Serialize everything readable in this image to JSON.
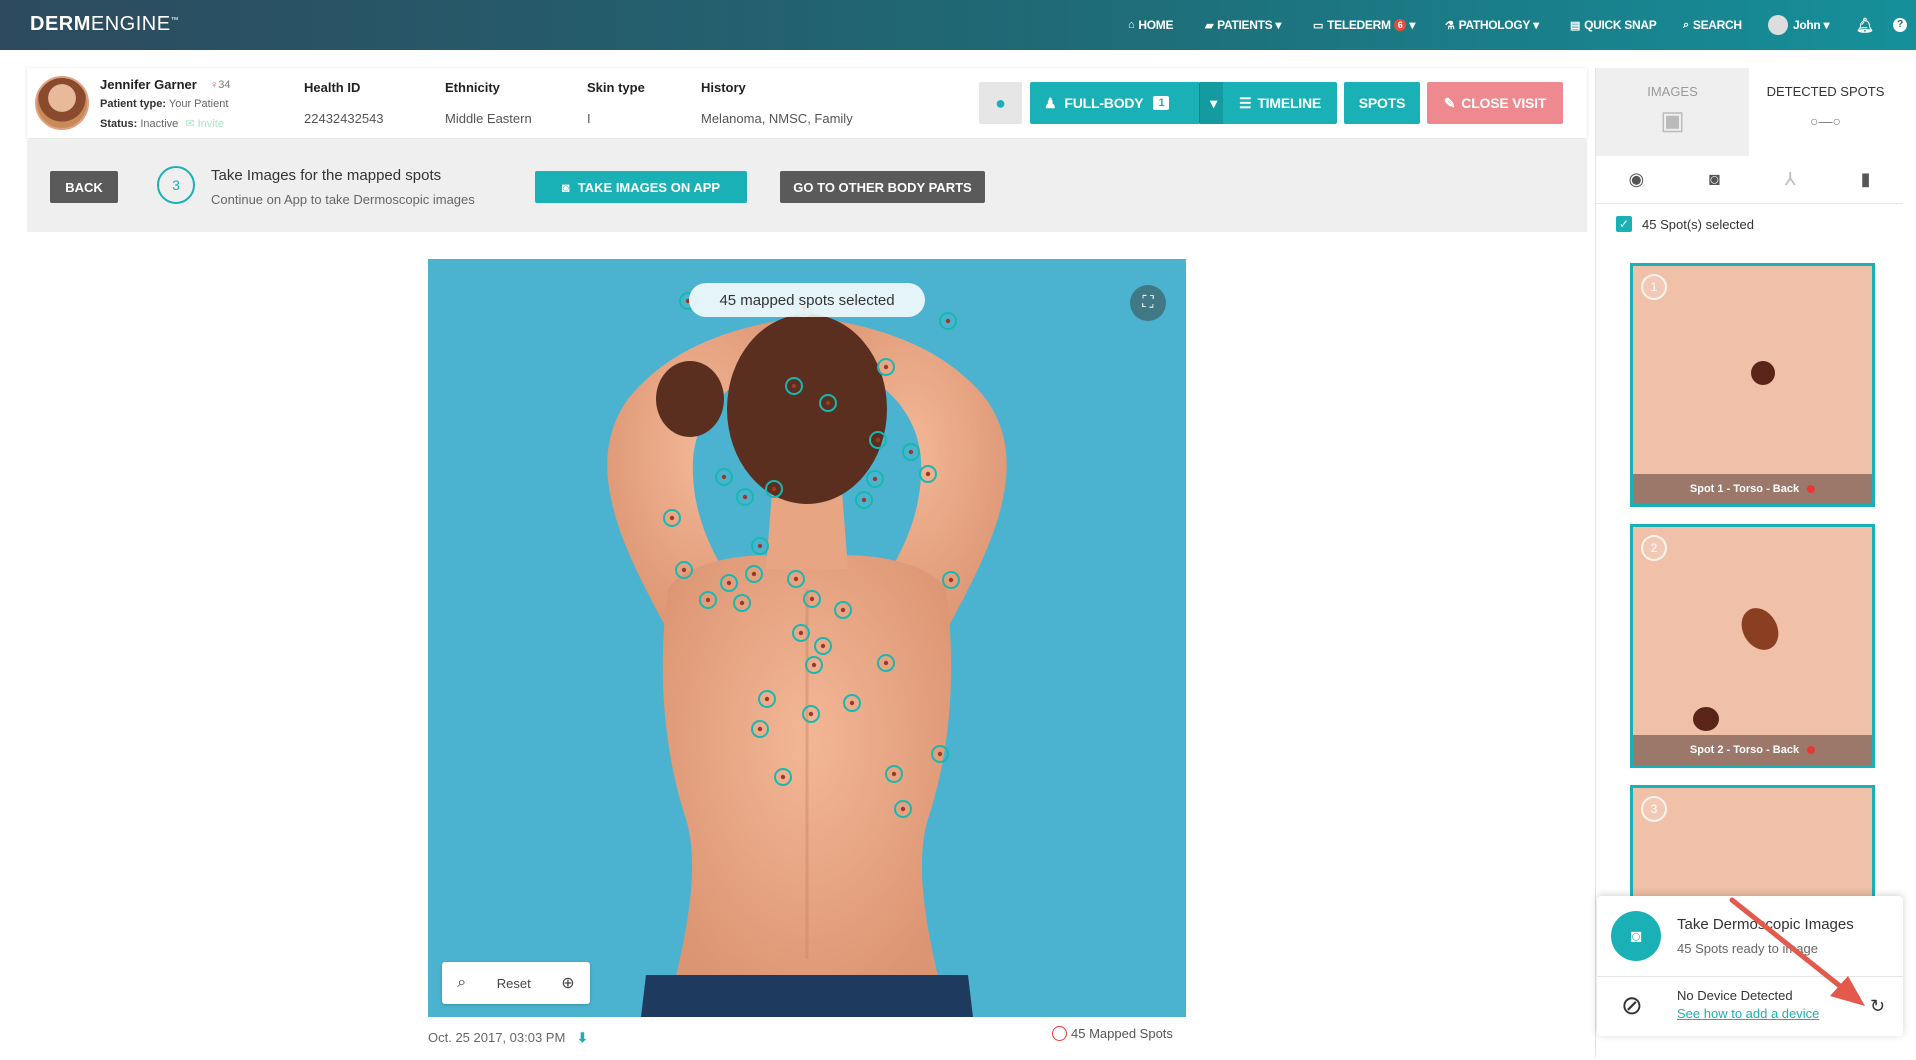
{
  "app": {
    "logo_bold": "DERM",
    "logo_light": "ENGINE",
    "logo_tm": "™"
  },
  "nav": {
    "home": "HOME",
    "patients": "PATIENTS",
    "telederm": "TELEDERM",
    "telederm_count": "6",
    "pathology": "PATHOLOGY",
    "quick_snap": "QUICK SNAP",
    "search": "SEARCH",
    "user": "John"
  },
  "patient": {
    "name": "Jennifer Garner",
    "age": "34",
    "type_label": "Patient type:",
    "type_value": "Your Patient",
    "status_label": "Status:",
    "status_value": "Inactive",
    "invite": "Invite",
    "health_id_label": "Health ID",
    "health_id": "22432432543",
    "ethnicity_label": "Ethnicity",
    "ethnicity": "Middle Eastern",
    "skin_type_label": "Skin type",
    "skin_type": "I",
    "history_label": "History",
    "history": "Melanoma, NMSC, Family"
  },
  "toolbar": {
    "full_body": "FULL-BODY",
    "full_body_count": "1",
    "timeline": "TIMELINE",
    "spots": "SPOTS",
    "close_visit": "CLOSE VISIT"
  },
  "step": {
    "back": "BACK",
    "number": "3",
    "title": "Take Images for the mapped spots",
    "subtitle": "Continue on App to take Dermoscopic images",
    "take_images": "TAKE IMAGES ON APP",
    "other_parts": "GO TO OTHER BODY PARTS"
  },
  "viewer": {
    "selected_pill": "45 mapped spots selected",
    "reset": "Reset",
    "date": "Oct. 25 2017, 03:03 PM",
    "mapped_spots": "45 Mapped Spots"
  },
  "panel": {
    "tab_images": "IMAGES",
    "tab_detected": "DETECTED SPOTS",
    "selected_text": "45 Spot(s) selected",
    "thumbs": [
      {
        "num": "1",
        "caption": "Spot 1 - Torso - Back"
      },
      {
        "num": "2",
        "caption": "Spot 2 - Torso - Back"
      },
      {
        "num": "3",
        "caption": ""
      }
    ]
  },
  "popup": {
    "title": "Take Dermoscopic Images",
    "subtitle": "45 Spots ready to image",
    "device_title": "No Device Detected",
    "device_link": "See how to add a device"
  },
  "colors": {
    "accent": "#1ab1b6",
    "danger": "#ee8a8f",
    "nav_dark": "#2d4a5e",
    "backdrop": "#4bb3d0"
  }
}
